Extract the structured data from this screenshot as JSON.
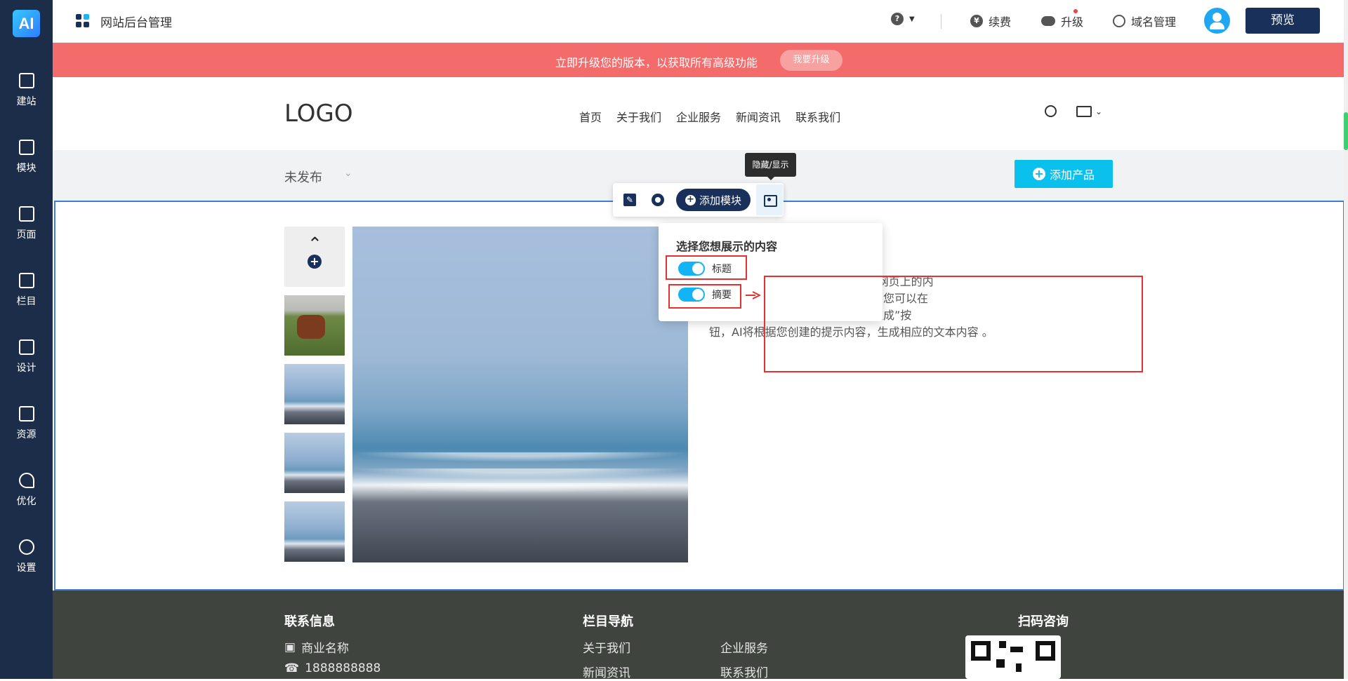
{
  "sidebar": {
    "logo": "AI",
    "items": [
      {
        "label": "建站",
        "icon": "ai-icon"
      },
      {
        "label": "模块",
        "icon": "module-icon"
      },
      {
        "label": "页面",
        "icon": "page-icon"
      },
      {
        "label": "栏目",
        "icon": "sitemap-icon"
      },
      {
        "label": "设计",
        "icon": "design-icon"
      },
      {
        "label": "资源",
        "icon": "image-icon"
      },
      {
        "label": "优化",
        "icon": "rocket-icon"
      },
      {
        "label": "设置",
        "icon": "settings-icon"
      }
    ]
  },
  "header": {
    "title": "网站后台管理",
    "help": "?",
    "renew": "续费",
    "upgrade": "升级",
    "domain": "域名管理",
    "preview": "预览"
  },
  "banner": {
    "text": "立即升级您的版本，以获取所有高级功能",
    "button": "我要升级"
  },
  "site": {
    "logo": "LOGO",
    "nav": [
      "首页",
      "关于我们",
      "企业服务",
      "新闻资讯",
      "联系我们"
    ],
    "status": "未发布",
    "add_product": "添加产品"
  },
  "editor": {
    "tooltip": "隐藏/显示",
    "add_module": "添加模块",
    "popover_title": "选择您想展示的内容",
    "toggles": [
      "标题",
      "摘要"
    ]
  },
  "content": {
    "description_lines": [
      "用户提供多种AI工具，帮助您完善网页上的内",
      "手”图标，会弹出AI写手工具弹窗，您可以在",
      "容的简短描述，然后点击“使用AI生成”按",
      "钮，AI将根据您创建的提示内容，生成相应的文本内容 。"
    ]
  },
  "footer": {
    "contact_title": "联系信息",
    "company": "商业名称",
    "phone": "1888888888",
    "nav_title": "栏目导航",
    "links": [
      "关于我们",
      "企业服务",
      "新闻资讯",
      "联系我们"
    ],
    "qr_title": "扫码咨询"
  },
  "colors": {
    "sidebar": "#1c2d4a",
    "banner": "#f36b6b",
    "accent": "#0ac0ec",
    "highlight": "#e43131"
  }
}
